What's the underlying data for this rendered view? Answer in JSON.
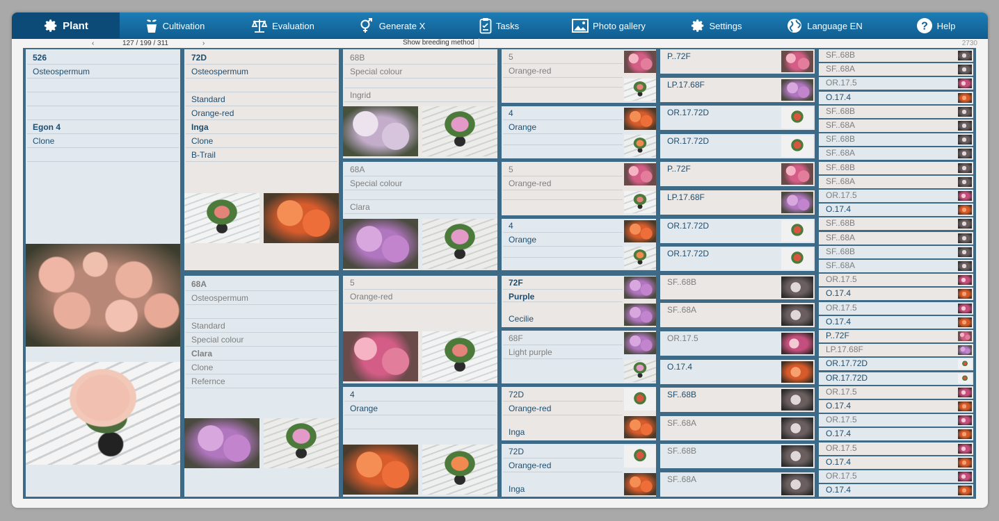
{
  "nav": {
    "items": [
      {
        "label": "Plant",
        "icon": "gear-icon",
        "active": true
      },
      {
        "label": "Cultivation",
        "icon": "pot-icon"
      },
      {
        "label": "Evaluation",
        "icon": "scale-icon"
      },
      {
        "label": "Generate X",
        "icon": "gender-icon"
      },
      {
        "label": "Tasks",
        "icon": "clipboard-icon"
      },
      {
        "label": "Photo gallery",
        "icon": "photo-icon"
      },
      {
        "label": "Settings",
        "icon": "gear-icon"
      },
      {
        "label": "Language EN",
        "icon": "globe-icon"
      },
      {
        "label": "Help",
        "icon": "help-icon"
      }
    ]
  },
  "pager": {
    "prev": "‹",
    "counter": "127 / 199 / 311",
    "next": "›",
    "breeding_button": "Show breeding method",
    "total": "2730"
  },
  "col1": {
    "lines": [
      "526",
      "Osteospermum",
      "",
      "",
      "",
      "Egon 4",
      "Clone",
      "",
      ""
    ]
  },
  "col2": {
    "top": {
      "lines": [
        "72D",
        "Osteospermum",
        "",
        "Standard",
        "Orange-red",
        "Inga",
        "Clone",
        "B-Trail"
      ]
    },
    "bottom": {
      "lines": [
        "68A",
        "Osteospermum",
        "",
        "Standard",
        "Special colour",
        "Clara",
        "Clone",
        "Refernce"
      ]
    }
  },
  "col3": [
    {
      "lines": [
        "68B",
        "Special colour",
        "",
        "Ingrid"
      ]
    },
    {
      "lines": [
        "68A",
        "Special colour",
        "",
        "Clara"
      ]
    },
    {
      "lines": [
        "5",
        "Orange-red",
        "",
        ""
      ]
    },
    {
      "lines": [
        "4",
        "Orange",
        "",
        ""
      ]
    }
  ],
  "col4": [
    {
      "lines": [
        "5",
        "Orange-red",
        ""
      ]
    },
    {
      "lines": [
        "4",
        "Orange",
        ""
      ]
    },
    {
      "lines": [
        "5",
        "Orange-red",
        ""
      ]
    },
    {
      "lines": [
        "4",
        "Orange",
        ""
      ]
    },
    {
      "lines": [
        "72F",
        "Purple",
        "Cecilie"
      ]
    },
    {
      "lines": [
        "68F",
        "Light purple",
        ""
      ]
    },
    {
      "lines": [
        "72D",
        "Orange-red",
        "Inga"
      ]
    },
    {
      "lines": [
        "72D",
        "Orange-red",
        "Inga"
      ]
    }
  ],
  "col5": [
    "P..72F",
    "LP.17.68F",
    "OR.17.72D",
    "OR.17.72D",
    "P..72F",
    "LP.17.68F",
    "OR.17.72D",
    "OR.17.72D",
    "SF..68B",
    "SF..68A",
    "OR.17.5",
    "O.17.4",
    "SF..68B",
    "SF..68A",
    "SF..68B",
    "SF..68A"
  ],
  "col6": [
    "SF..68B",
    "SF..68A",
    "OR.17.5",
    "O.17.4",
    "SF..68B",
    "SF..68A",
    "SF..68B",
    "SF..68A",
    "SF..68B",
    "SF..68A",
    "OR.17.5",
    "O.17.4",
    "SF..68B",
    "SF..68A",
    "SF..68B",
    "SF..68A",
    "OR.17.5",
    "O.17.4",
    "OR.17.5",
    "O.17.4",
    "P..72F",
    "LP.17.68F",
    "OR.17.72D",
    "OR.17.72D",
    "OR.17.5",
    "O.17.4",
    "OR.17.5",
    "O.17.4",
    "OR.17.5",
    "O.17.4",
    "OR.17.5",
    "O.17.4"
  ]
}
